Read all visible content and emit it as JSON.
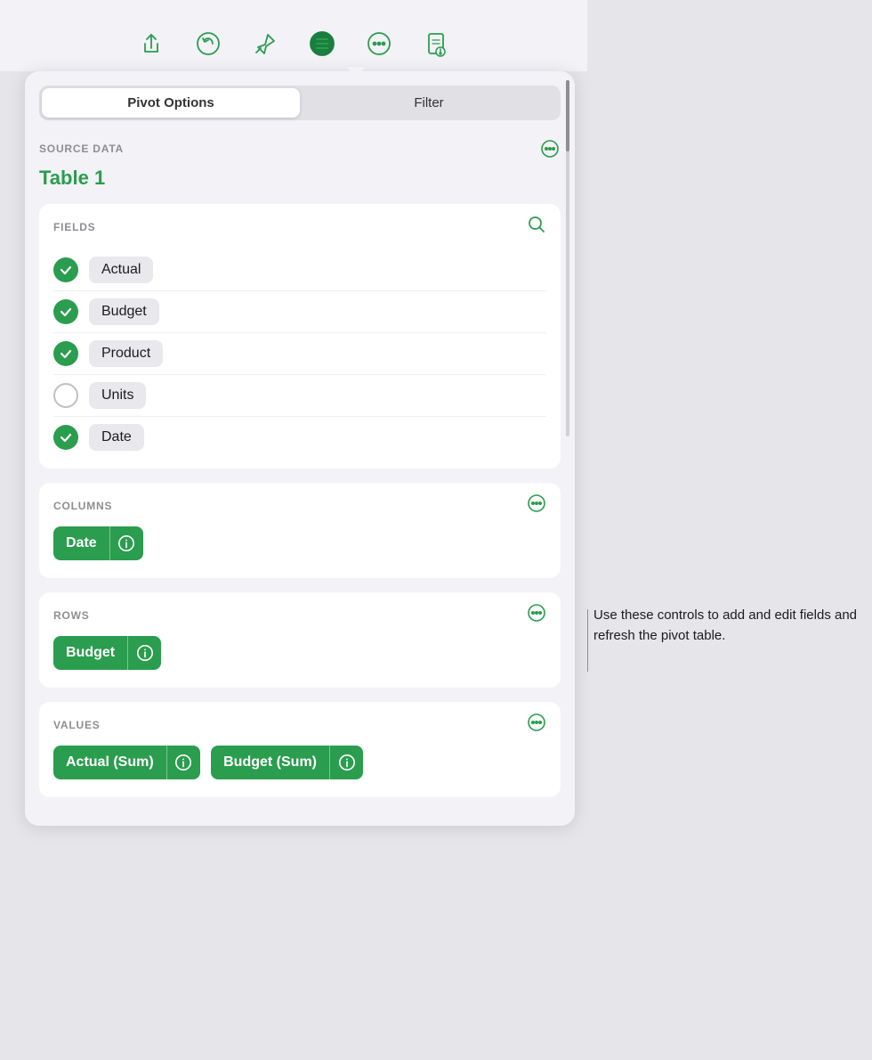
{
  "toolbar": {
    "icons": [
      {
        "name": "share-icon",
        "label": "Share"
      },
      {
        "name": "undo-icon",
        "label": "Undo"
      },
      {
        "name": "pin-icon",
        "label": "Pin"
      },
      {
        "name": "menu-icon",
        "label": "Menu",
        "active": true
      },
      {
        "name": "more-icon",
        "label": "More"
      },
      {
        "name": "document-icon",
        "label": "Document"
      }
    ]
  },
  "tabs": [
    {
      "label": "Pivot Options",
      "active": true
    },
    {
      "label": "Filter",
      "active": false
    }
  ],
  "source_data": {
    "section_label": "SOURCE DATA",
    "table_name": "Table 1"
  },
  "fields": {
    "section_label": "FIELDS",
    "items": [
      {
        "label": "Actual",
        "checked": true
      },
      {
        "label": "Budget",
        "checked": true
      },
      {
        "label": "Product",
        "checked": true
      },
      {
        "label": "Units",
        "checked": false
      },
      {
        "label": "Date",
        "checked": true
      }
    ]
  },
  "columns": {
    "section_label": "COLUMNS",
    "pills": [
      {
        "label": "Date"
      }
    ]
  },
  "rows": {
    "section_label": "ROWS",
    "pills": [
      {
        "label": "Budget"
      }
    ]
  },
  "values": {
    "section_label": "VALUES",
    "pills": [
      {
        "label": "Actual (Sum)"
      },
      {
        "label": "Budget (Sum)"
      }
    ]
  },
  "tooltip": {
    "text": "Use these controls to add and edit fields and refresh the pivot table."
  }
}
